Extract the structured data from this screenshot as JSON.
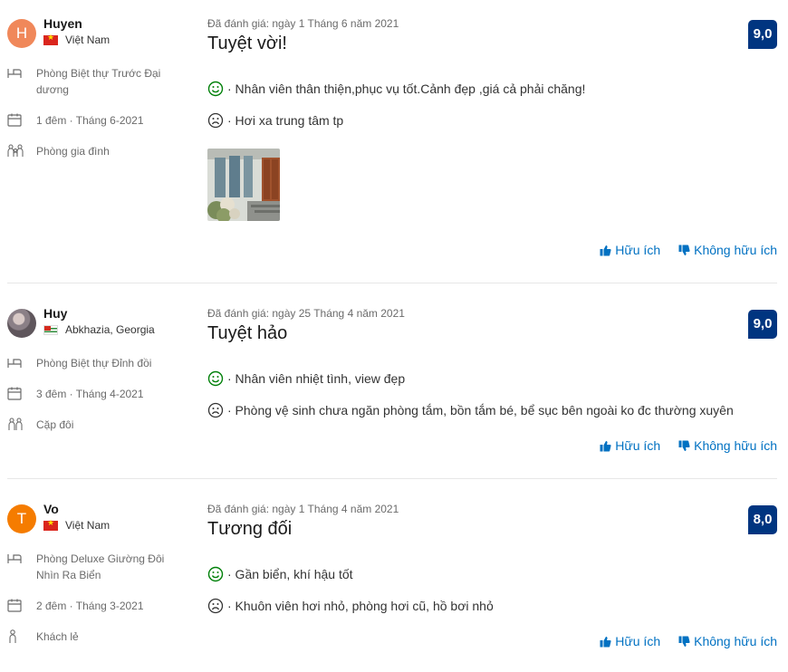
{
  "reviews": [
    {
      "user": {
        "name": "Huyen",
        "initial": "H",
        "avatar_color": "#f0885a",
        "country": "Việt Nam",
        "flag": "vn"
      },
      "room": "Phòng Biệt thự Trước Đại dương",
      "stay": "1 đêm · Tháng 6-2021",
      "traveler_type": "Phòng gia đình",
      "date": "Đã đánh giá: ngày 1 Tháng 6 năm 2021",
      "title": "Tuyệt vời!",
      "score": "9,0",
      "liked": "· Nhân viên thân thiện,phục vụ tốt.Cảnh đẹp ,giá cả phải chăng!",
      "disliked": "· Hơi xa trung tâm tp",
      "has_photo": true,
      "helpful": "Hữu ích",
      "not_helpful": "Không hữu ích"
    },
    {
      "user": {
        "name": "Huy",
        "initial": "",
        "avatar_color": "#8a7f86",
        "country": "Abkhazia, Georgia",
        "flag": "ab"
      },
      "room": "Phòng Biệt thự Đỉnh đồi",
      "stay": "3 đêm · Tháng 4-2021",
      "traveler_type": "Cặp đôi",
      "date": "Đã đánh giá: ngày 25 Tháng 4 năm 2021",
      "title": "Tuyệt hảo",
      "score": "9,0",
      "liked": "· Nhân viên nhiệt tình, view đẹp",
      "disliked": "· Phòng vệ sinh chưa ngăn phòng tắm, bồn tắm bé, bể sục bên ngoài ko đc thường xuyên",
      "has_photo": false,
      "helpful": "Hữu ích",
      "not_helpful": "Không hữu ích"
    },
    {
      "user": {
        "name": "Vo",
        "initial": "T",
        "avatar_color": "#f57c00",
        "country": "Việt Nam",
        "flag": "vn"
      },
      "room": "Phòng Deluxe Giường Đôi Nhìn Ra Biển",
      "stay": "2 đêm · Tháng 3-2021",
      "traveler_type": "Khách lẻ",
      "date": "Đã đánh giá: ngày 1 Tháng 4 năm 2021",
      "title": "Tương đối",
      "score": "8,0",
      "liked": "· Gần biển, khí hậu tốt",
      "disliked": "· Khuôn viên hơi nhỏ, phòng hơi cũ, hồ bơi nhỏ",
      "has_photo": false,
      "helpful": "Hữu ích",
      "not_helpful": "Không hữu ích"
    }
  ],
  "colors": {
    "score_bg": "#003580",
    "link": "#0071c2",
    "liked": "#008009",
    "disliked": "#333333"
  }
}
